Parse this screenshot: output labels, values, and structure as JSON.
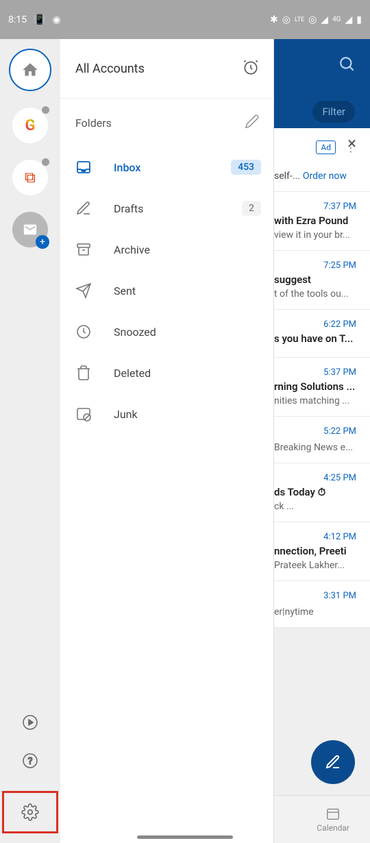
{
  "status": {
    "time": "8:15",
    "network": "4G"
  },
  "header": {
    "filter": "Filter"
  },
  "drawer": {
    "title": "All Accounts",
    "folders_label": "Folders",
    "folders": [
      {
        "label": "Inbox",
        "badge": "453",
        "selected": true
      },
      {
        "label": "Drafts",
        "count": "2"
      },
      {
        "label": "Archive"
      },
      {
        "label": "Sent"
      },
      {
        "label": "Snoozed"
      },
      {
        "label": "Deleted"
      },
      {
        "label": "Junk"
      }
    ]
  },
  "ad": {
    "label": "Ad",
    "text": "self-...",
    "link": "Order now"
  },
  "emails": [
    {
      "time": "7:37 PM",
      "subj": "with Ezra Pound",
      "prev": "view it in your br..."
    },
    {
      "time": "7:25 PM",
      "subj": "suggest",
      "prev": "t of the tools ou..."
    },
    {
      "time": "6:22 PM",
      "subj": "s you have on T...",
      "prev": ""
    },
    {
      "time": "5:37 PM",
      "subj": "rning Solutions ...",
      "prev": "nities matching ..."
    },
    {
      "time": "5:22 PM",
      "subj": "",
      "prev": "Breaking News e..."
    },
    {
      "time": "4:25 PM",
      "subj": "ds Today ⏱",
      "prev": "ck                         ..."
    },
    {
      "time": "4:12 PM",
      "subj": "nnection, Preeti",
      "prev": "Prateek Lakher..."
    },
    {
      "time": "3:31 PM",
      "subj": "",
      "prev": "er|nytime"
    }
  ],
  "bottom_nav": {
    "calendar": "Calendar"
  }
}
